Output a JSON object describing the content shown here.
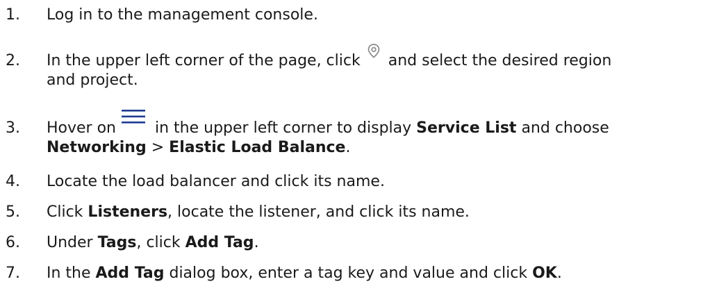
{
  "steps": [
    {
      "number": "1.",
      "parts": [
        "Log in to the management console."
      ]
    },
    {
      "number": "2.",
      "before_icon": "In the upper left corner of the page, click",
      "icon": "location-pin-icon",
      "after_icon": "and select the desired region",
      "line2": "and project."
    },
    {
      "number": "3.",
      "before_icon": "Hover on",
      "icon": "hamburger-menu-icon",
      "after_icon": "in the upper left corner to display",
      "bold1": "Service List",
      "after_bold1": "and choose",
      "line2_bold1": "Networking",
      "line2_sep": ">",
      "line2_bold2": "Elastic Load Balance",
      "line2_end": "."
    },
    {
      "number": "4.",
      "parts": [
        "Locate the load balancer and click its name."
      ]
    },
    {
      "number": "5.",
      "pre": "Click",
      "bold1": "Listeners",
      "rest": ", locate the listener, and click its name."
    },
    {
      "number": "6.",
      "pre": "Under",
      "bold1": "Tags",
      "mid": ", click",
      "bold2": "Add Tag",
      "end": "."
    },
    {
      "number": "7.",
      "pre": "In the",
      "bold1": "Add Tag",
      "mid": "dialog box, enter a tag key and value and click",
      "bold2": "OK",
      "end": "."
    }
  ],
  "colors": {
    "text": "#1a1a1a",
    "icon_pin": "#8a8a8a",
    "icon_menu": "#1f3a93"
  }
}
